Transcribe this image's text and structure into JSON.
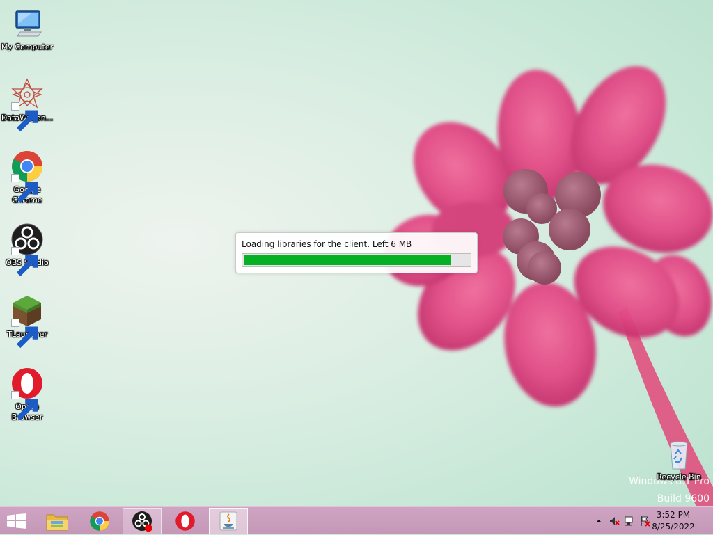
{
  "desktop": {
    "icons": [
      {
        "label": "My Computer",
        "icon": "computer-icon",
        "shortcut": false
      },
      {
        "label": "DataWagon...",
        "icon": "datawagon-icon",
        "shortcut": true
      },
      {
        "label": "Google Chrome",
        "icon": "chrome-icon",
        "shortcut": true
      },
      {
        "label": "OBS Studio",
        "icon": "obs-icon",
        "shortcut": true
      },
      {
        "label": "TLauncher",
        "icon": "tlauncher-icon",
        "shortcut": true
      },
      {
        "label": "Opera Browser",
        "icon": "opera-icon",
        "shortcut": true
      }
    ],
    "recycle_bin": {
      "label": "Recycle Bin",
      "icon": "recycle-bin-icon"
    },
    "watermark": {
      "line1": "Windows 8.1 Pro",
      "line2": "Build 9600"
    }
  },
  "progress_dialog": {
    "message": "Loading libraries for the client. Left 6 MB",
    "progress": 0.92,
    "color": "#06b025"
  },
  "taskbar": {
    "start": {
      "icon": "windows-logo-icon"
    },
    "items": [
      {
        "name": "file-explorer",
        "icon": "folder-icon",
        "state": "normal"
      },
      {
        "name": "chrome",
        "icon": "chrome-icon",
        "state": "normal"
      },
      {
        "name": "obs-studio",
        "icon": "obs-icon",
        "state": "active"
      },
      {
        "name": "opera",
        "icon": "opera-icon",
        "state": "normal"
      },
      {
        "name": "java",
        "icon": "java-icon",
        "state": "highlight"
      }
    ],
    "tray": {
      "icons": [
        "show-hidden-icons-chevron",
        "volume-muted-icon",
        "network-disconnected-icon",
        "action-center-flag-icon"
      ]
    },
    "clock": {
      "time": "3:52 PM",
      "date": "8/25/2022"
    }
  },
  "colors": {
    "taskbar": "#c99bbb",
    "flower": "#e0457f",
    "progress": "#06b025"
  }
}
